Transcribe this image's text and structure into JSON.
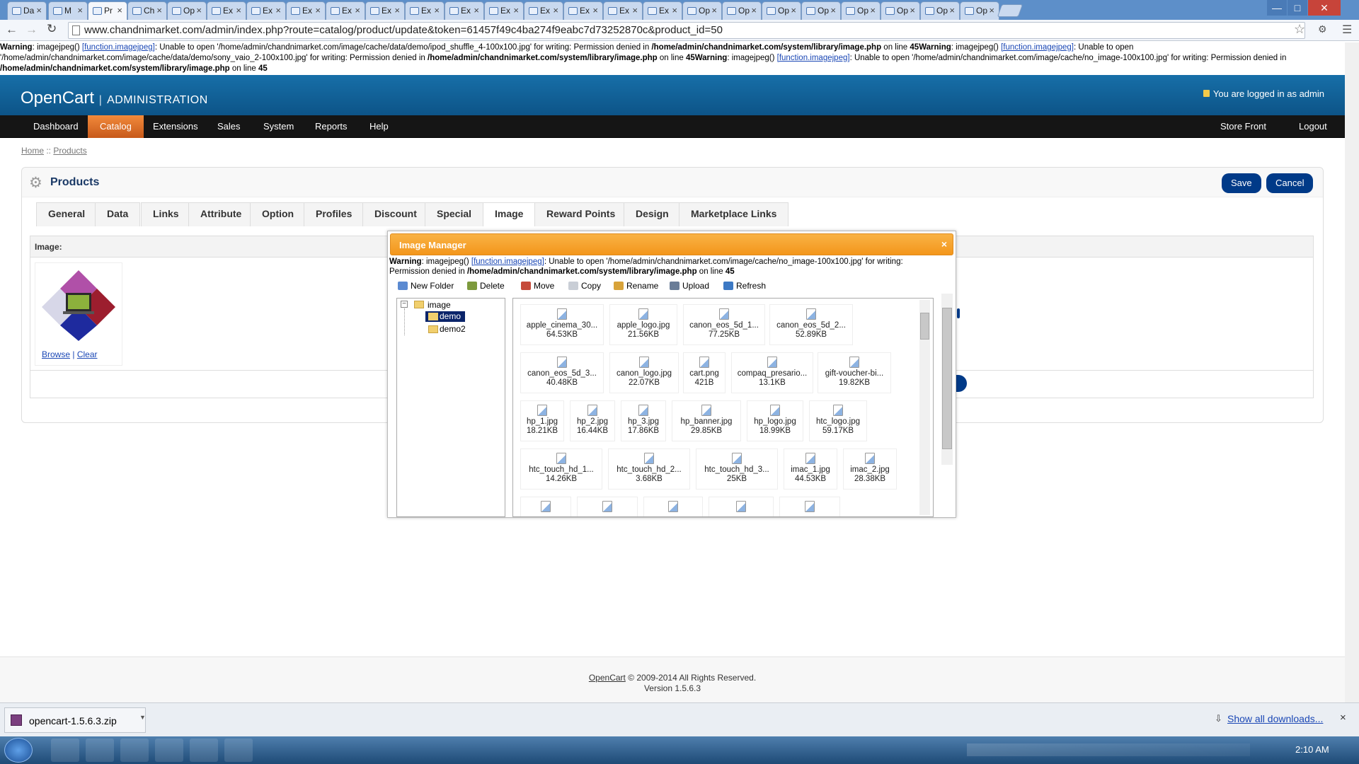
{
  "browser": {
    "tabs": [
      {
        "label": "Da",
        "icon": "gmail-icon",
        "active": false
      },
      {
        "label": "M",
        "icon": "mail-icon",
        "active": false
      },
      {
        "label": "Pr",
        "icon": "page-icon",
        "active": true
      },
      {
        "label": "Ch",
        "icon": "page-icon",
        "active": false
      },
      {
        "label": "Op",
        "icon": "page-icon",
        "active": false
      },
      {
        "label": "Ex",
        "icon": "page-icon",
        "active": false
      },
      {
        "label": "Ex",
        "icon": "page-icon",
        "active": false
      },
      {
        "label": "Ex",
        "icon": "page-icon",
        "active": false
      },
      {
        "label": "Ex",
        "icon": "page-icon",
        "active": false
      },
      {
        "label": "Ex",
        "icon": "page-icon",
        "active": false
      },
      {
        "label": "Ex",
        "icon": "page-icon",
        "active": false
      },
      {
        "label": "Ex",
        "icon": "page-icon",
        "active": false
      },
      {
        "label": "Ex",
        "icon": "page-icon",
        "active": false
      },
      {
        "label": "Ex",
        "icon": "page-icon",
        "active": false
      },
      {
        "label": "Ex",
        "icon": "page-icon",
        "active": false
      },
      {
        "label": "Ex",
        "icon": "page-icon",
        "active": false
      },
      {
        "label": "Ex",
        "icon": "page-icon",
        "active": false
      },
      {
        "label": "Op",
        "icon": "page-icon",
        "active": false
      },
      {
        "label": "Op",
        "icon": "page-icon",
        "active": false
      },
      {
        "label": "Op",
        "icon": "page-icon",
        "active": false
      },
      {
        "label": "Op",
        "icon": "page-icon",
        "active": false
      },
      {
        "label": "Op",
        "icon": "page-icon",
        "active": false
      },
      {
        "label": "Op",
        "icon": "page-icon",
        "active": false
      },
      {
        "label": "Op",
        "icon": "page-icon",
        "active": false
      },
      {
        "label": "Op",
        "icon": "page-icon",
        "active": false
      }
    ],
    "url": "www.chandnimarket.com/admin/index.php?route=catalog/product/update&token=61457f49c4ba274f9eabc7d73252870c&product_id=50"
  },
  "page_warning": {
    "w1_label": "Warning",
    "w1_a": ": imagejpeg() ",
    "w1_link": "[function.imagejpeg]",
    "w1_b": ": Unable to open '/home/admin/chandnimarket.com/image/cache/data/demo/ipod_shuffle_4-100x100.jpg' for writing: Permission denied in ",
    "w1_file": "/home/admin/chandnimarket.com/system/library/image.php",
    "w1_c": " on line ",
    "w1_line": "45",
    "w2_label": "Warning",
    "w2_a": ": imagejpeg() ",
    "w2_link": "[function.imagejpeg]",
    "w2_b": ": Unable to open '/home/admin/chandnimarket.com/image/cache/data/demo/sony_vaio_2-100x100.jpg' for writing: Permission denied in ",
    "w2_file": "/home/admin/chandnimarket.com/system/library/image.php",
    "w2_c": " on line ",
    "w2_line": "45",
    "w3_label": "Warning",
    "w3_a": ": imagejpeg() ",
    "w3_link": "[function.imagejpeg]",
    "w3_b": ": Unable to open '/home/admin/chandnimarket.com/image/cache/no_image-100x100.jpg' for writing: Permission denied in ",
    "w3_file": "/home/admin/chandnimarket.com/system/library/image.php",
    "w3_c": " on line ",
    "w3_line": "45"
  },
  "header": {
    "logo": "OpenCart",
    "admin": "ADMINISTRATION",
    "logged_in": "You are logged in as admin"
  },
  "menu": {
    "items": [
      "Dashboard",
      "Catalog",
      "Extensions",
      "Sales",
      "System",
      "Reports",
      "Help"
    ],
    "active": "Catalog",
    "right": [
      "Store Front",
      "Logout"
    ]
  },
  "breadcrumb": {
    "home": "Home",
    "sep": " :: ",
    "products": "Products"
  },
  "panel": {
    "title": "Products",
    "save": "Save",
    "cancel": "Cancel",
    "tabs": [
      "General",
      "Data",
      "Links",
      "Attribute",
      "Option",
      "Profiles",
      "Discount",
      "Special",
      "Image",
      "Reward Points",
      "Design",
      "Marketplace Links"
    ],
    "active_tab": "Image",
    "image_label": "Image:",
    "browse": "Browse",
    "sep": "|",
    "clear": "Clear"
  },
  "image_manager": {
    "title": "Image Manager",
    "close": "×",
    "warning": {
      "label": "Warning",
      "a": ": imagejpeg() ",
      "link": "[function.imagejpeg]",
      "b": ": Unable to open '/home/admin/chandnimarket.com/image/cache/no_image-100x100.jpg' for writing: Permission denied in ",
      "file": "/home/admin/chandnimarket.com/system/library/image.php",
      "c": " on line ",
      "line": "45"
    },
    "tools": [
      "New Folder",
      "Delete",
      "Move",
      "Copy",
      "Rename",
      "Upload",
      "Refresh"
    ],
    "tree": {
      "root": "image",
      "folders": [
        "demo",
        "demo2"
      ],
      "selected": "demo"
    },
    "files": [
      [
        {
          "name": "apple_cinema_30...",
          "size": "64.53KB"
        },
        {
          "name": "apple_logo.jpg",
          "size": "21.56KB"
        },
        {
          "name": "canon_eos_5d_1...",
          "size": "77.25KB"
        },
        {
          "name": "canon_eos_5d_2...",
          "size": "52.89KB"
        }
      ],
      [
        {
          "name": "canon_eos_5d_3...",
          "size": "40.48KB"
        },
        {
          "name": "canon_logo.jpg",
          "size": "22.07KB"
        },
        {
          "name": "cart.png",
          "size": "421B"
        },
        {
          "name": "compaq_presario...",
          "size": "13.1KB"
        },
        {
          "name": "gift-voucher-bi...",
          "size": "19.82KB"
        }
      ],
      [
        {
          "name": "hp_1.jpg",
          "size": "18.21KB"
        },
        {
          "name": "hp_2.jpg",
          "size": "16.44KB"
        },
        {
          "name": "hp_3.jpg",
          "size": "17.86KB"
        },
        {
          "name": "hp_banner.jpg",
          "size": "29.85KB"
        },
        {
          "name": "hp_logo.jpg",
          "size": "18.99KB"
        },
        {
          "name": "htc_logo.jpg",
          "size": "59.17KB"
        }
      ],
      [
        {
          "name": "htc_touch_hd_1...",
          "size": "14.26KB"
        },
        {
          "name": "htc_touch_hd_2...",
          "size": "3.68KB"
        },
        {
          "name": "htc_touch_hd_3...",
          "size": "25KB"
        },
        {
          "name": "imac_1.jpg",
          "size": "44.53KB"
        },
        {
          "name": "imac_2.jpg",
          "size": "28.38KB"
        }
      ]
    ]
  },
  "footer": {
    "link": "OpenCart",
    "copy": " © 2009-2014 All Rights Reserved.",
    "version": "Version 1.5.6.3"
  },
  "downloads": {
    "file": "opencart-1.5.6.3.zip",
    "show_all": "Show all downloads...",
    "close": "×"
  },
  "taskbar": {
    "time": "2:10 AM",
    "apps": [
      "chrome-icon",
      "chrome-dev-icon",
      "skype-icon",
      "explorer-icon",
      "ftp-icon",
      "photoshop-icon"
    ]
  },
  "colors": {
    "header": "#0b5a8e",
    "menu": "#151515",
    "active_menu": "#e96d1f",
    "dialog_header": "#f6a023",
    "button": "#003a88"
  }
}
